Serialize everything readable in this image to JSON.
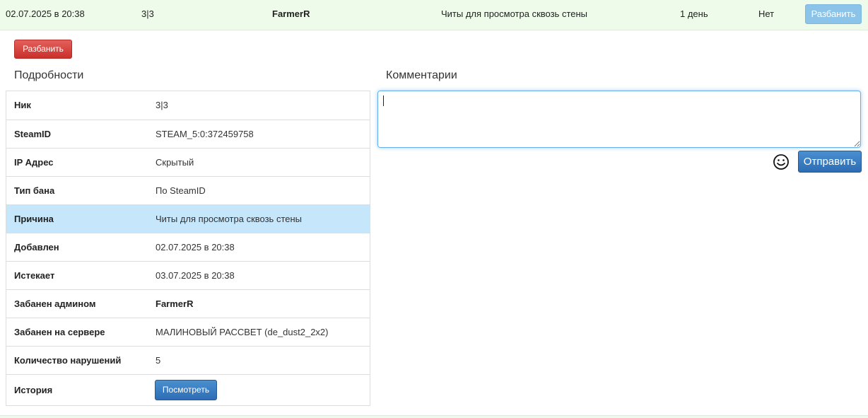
{
  "ban_row": {
    "date": "02.07.2025 в 20:38",
    "nick": "3|3",
    "admin": "FarmerR",
    "reason": "Читы для просмотра сквозь стены",
    "term": "1 день",
    "expired": "Нет",
    "unban_label": "Разбанить"
  },
  "actions": {
    "unban_label": "Разбанить"
  },
  "details": {
    "title": "Подробности",
    "rows": [
      {
        "label": "Ник",
        "value": "3|3"
      },
      {
        "label": "SteamID",
        "value": "STEAM_5:0:372459758"
      },
      {
        "label": "IP Адрес",
        "value": "Скрытый"
      },
      {
        "label": "Тип бана",
        "value": "По SteamID"
      },
      {
        "label": "Причина",
        "value": "Читы для просмотра сквозь стены"
      },
      {
        "label": "Добавлен",
        "value": "02.07.2025 в 20:38"
      },
      {
        "label": "Истекает",
        "value": "03.07.2025 в 20:38"
      },
      {
        "label": "Забанен админом",
        "value": "FarmerR"
      },
      {
        "label": "Забанен на сервере",
        "value": "МАЛИНОВЫЙ РАССВЕТ (de_dust2_2x2)"
      },
      {
        "label": "Количество нарушений",
        "value": "5"
      },
      {
        "label": "История",
        "button_label": "Посмотреть"
      }
    ]
  },
  "comments": {
    "title": "Комментарии",
    "input_value": "",
    "send_label": "Отправить",
    "emoji_icon": "smile-icon"
  },
  "colors": {
    "row_bg": "#eefbea",
    "highlight": "#c5e6fb",
    "danger": "#c9302c",
    "primary": "#2d6db4",
    "info_light": "#8cc3e8"
  }
}
